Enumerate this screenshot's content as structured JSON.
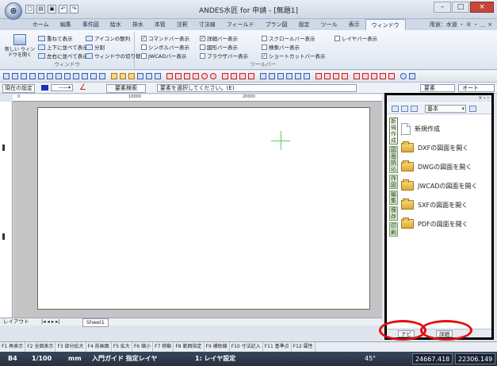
{
  "window": {
    "app_orb_icon": "compass-orb-icon",
    "title": "ANDES水匠 for 申請 - [無題1]",
    "controls": [
      "–",
      "□",
      "×"
    ]
  },
  "ribbon": {
    "tabs": [
      "ホーム",
      "編集",
      "事件図",
      "給水",
      "排水",
      "本管",
      "注釈",
      "寸法線",
      "フィールド",
      "プラン図",
      "設定",
      "ツール",
      "表示",
      "ウィンドウ"
    ],
    "active_tab": "ウィンドウ",
    "right_label": "用途：水道 ・ ② ・ ＿ ×",
    "groups": {
      "window": {
        "label": "ウィンドウ",
        "new_window": "新しい ウィンドウを開く",
        "items": [
          "重ねて表示",
          "上下に並べて表示",
          "左右に並べて表示",
          "アイコンの整列",
          "分割",
          "ウィンドウの切り替え"
        ]
      },
      "toolbar": {
        "label": "ツールバー",
        "items": [
          {
            "label": "コマンドバー表示",
            "checked": true
          },
          {
            "label": "シンボルバー表示",
            "checked": false
          },
          {
            "label": "JWCADバー表示",
            "checked": false
          },
          {
            "label": "詳細バー表示",
            "checked": true
          },
          {
            "label": "図形バー表示",
            "checked": false
          },
          {
            "label": "ブラウザバー表示",
            "checked": false
          },
          {
            "label": "スクロールバー表示",
            "checked": false
          },
          {
            "label": "検索バー表示",
            "checked": false
          },
          {
            "label": "ショートカットバー表示",
            "checked": true
          },
          {
            "label": "レイヤバー表示",
            "checked": false
          }
        ]
      }
    }
  },
  "propbar": {
    "current_setting": "現在の設定",
    "color": "#1e2fb8",
    "element_search": "要素検索",
    "message": "要素を選択してください。(E)",
    "dropdown_a": "要素",
    "dropdown_b": "オート"
  },
  "ruler": {
    "ticks": [
      "0",
      "10000",
      "20000"
    ]
  },
  "sheetbar": {
    "layout": "レイアウト",
    "nav": "|◂ ◂ ▸ ▸|",
    "sheet": "Sheet1"
  },
  "panel": {
    "mode_select": "基本",
    "tabs": [
      "新規作成",
      "図面読込",
      "作図",
      "編集",
      "保存",
      "印刷"
    ],
    "active_tab_index": 0,
    "items": [
      {
        "label": "新規作成",
        "icon": "new-document-icon"
      },
      {
        "label": "DXFの図面を開く",
        "icon": "open-folder-icon"
      },
      {
        "label": "DWGの図面を開く",
        "icon": "open-folder-icon"
      },
      {
        "label": "JWCADの図面を開く",
        "icon": "open-folder-icon"
      },
      {
        "label": "SXFの図面を開く",
        "icon": "open-folder-icon"
      },
      {
        "label": "PDFの図面を開く",
        "icon": "open-folder-icon"
      }
    ],
    "bottom_tabs": [
      "ナビ",
      "詳細"
    ]
  },
  "cmdbar": {
    "items": [
      "F1 再表示",
      "F2 全図表示",
      "F3 部分拡大",
      "F4 前画面",
      "F5 拡大",
      "F6 縮小",
      "F7 移動",
      "F8 範囲指定",
      "F9 補助線",
      "F10 寸法記入",
      "F11 基準点",
      "F12 属性"
    ]
  },
  "status": {
    "paper": "B4",
    "scale": "1/100",
    "unit": "mm",
    "guide": "入門ガイド 指定レイヤ",
    "layer": "1: レイヤ設定",
    "angle": "45°",
    "x": "24667.418",
    "y": "22306.149"
  }
}
